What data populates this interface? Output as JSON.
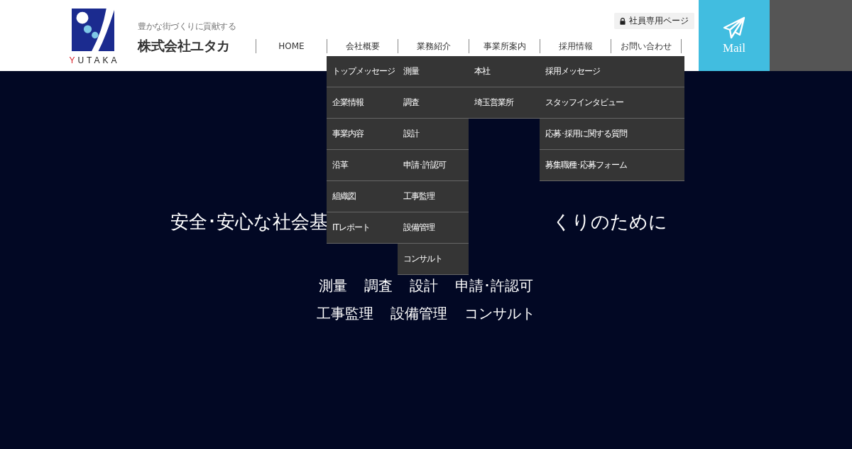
{
  "header": {
    "logo_text": "YUTAKA",
    "tagline": "豊かな街づくりに貢献する",
    "company": "株式会社ユタカ",
    "staff_link": "社員専用ページ",
    "mail": "Mail"
  },
  "nav": [
    {
      "label": "HOME"
    },
    {
      "label": "会社概要",
      "submenu": [
        "トップメッセージ",
        "企業情報",
        "事業内容",
        "沿革",
        "組織図",
        "ITレポート"
      ]
    },
    {
      "label": "業務紹介",
      "submenu": [
        "測量",
        "調査",
        "設計",
        "申請･許認可",
        "工事監理",
        "設備管理",
        "コンサルト"
      ]
    },
    {
      "label": "事業所案内",
      "submenu": [
        "本社",
        "埼玉営業所"
      ]
    },
    {
      "label": "採用情報",
      "submenu": [
        "採用メッセージ",
        "スタッフインタビュー",
        "応募･採用に関する質問",
        "募集職種･応募フォーム"
      ]
    },
    {
      "label": "お問い合わせ"
    }
  ],
  "hero": {
    "heading_left": "安全･安心な社会基",
    "heading_right": "くりのために",
    "services": [
      [
        "測量",
        "調査",
        "設計",
        "申請･許認可"
      ],
      [
        "工事監理",
        "設備管理",
        "コンサルト"
      ]
    ]
  }
}
